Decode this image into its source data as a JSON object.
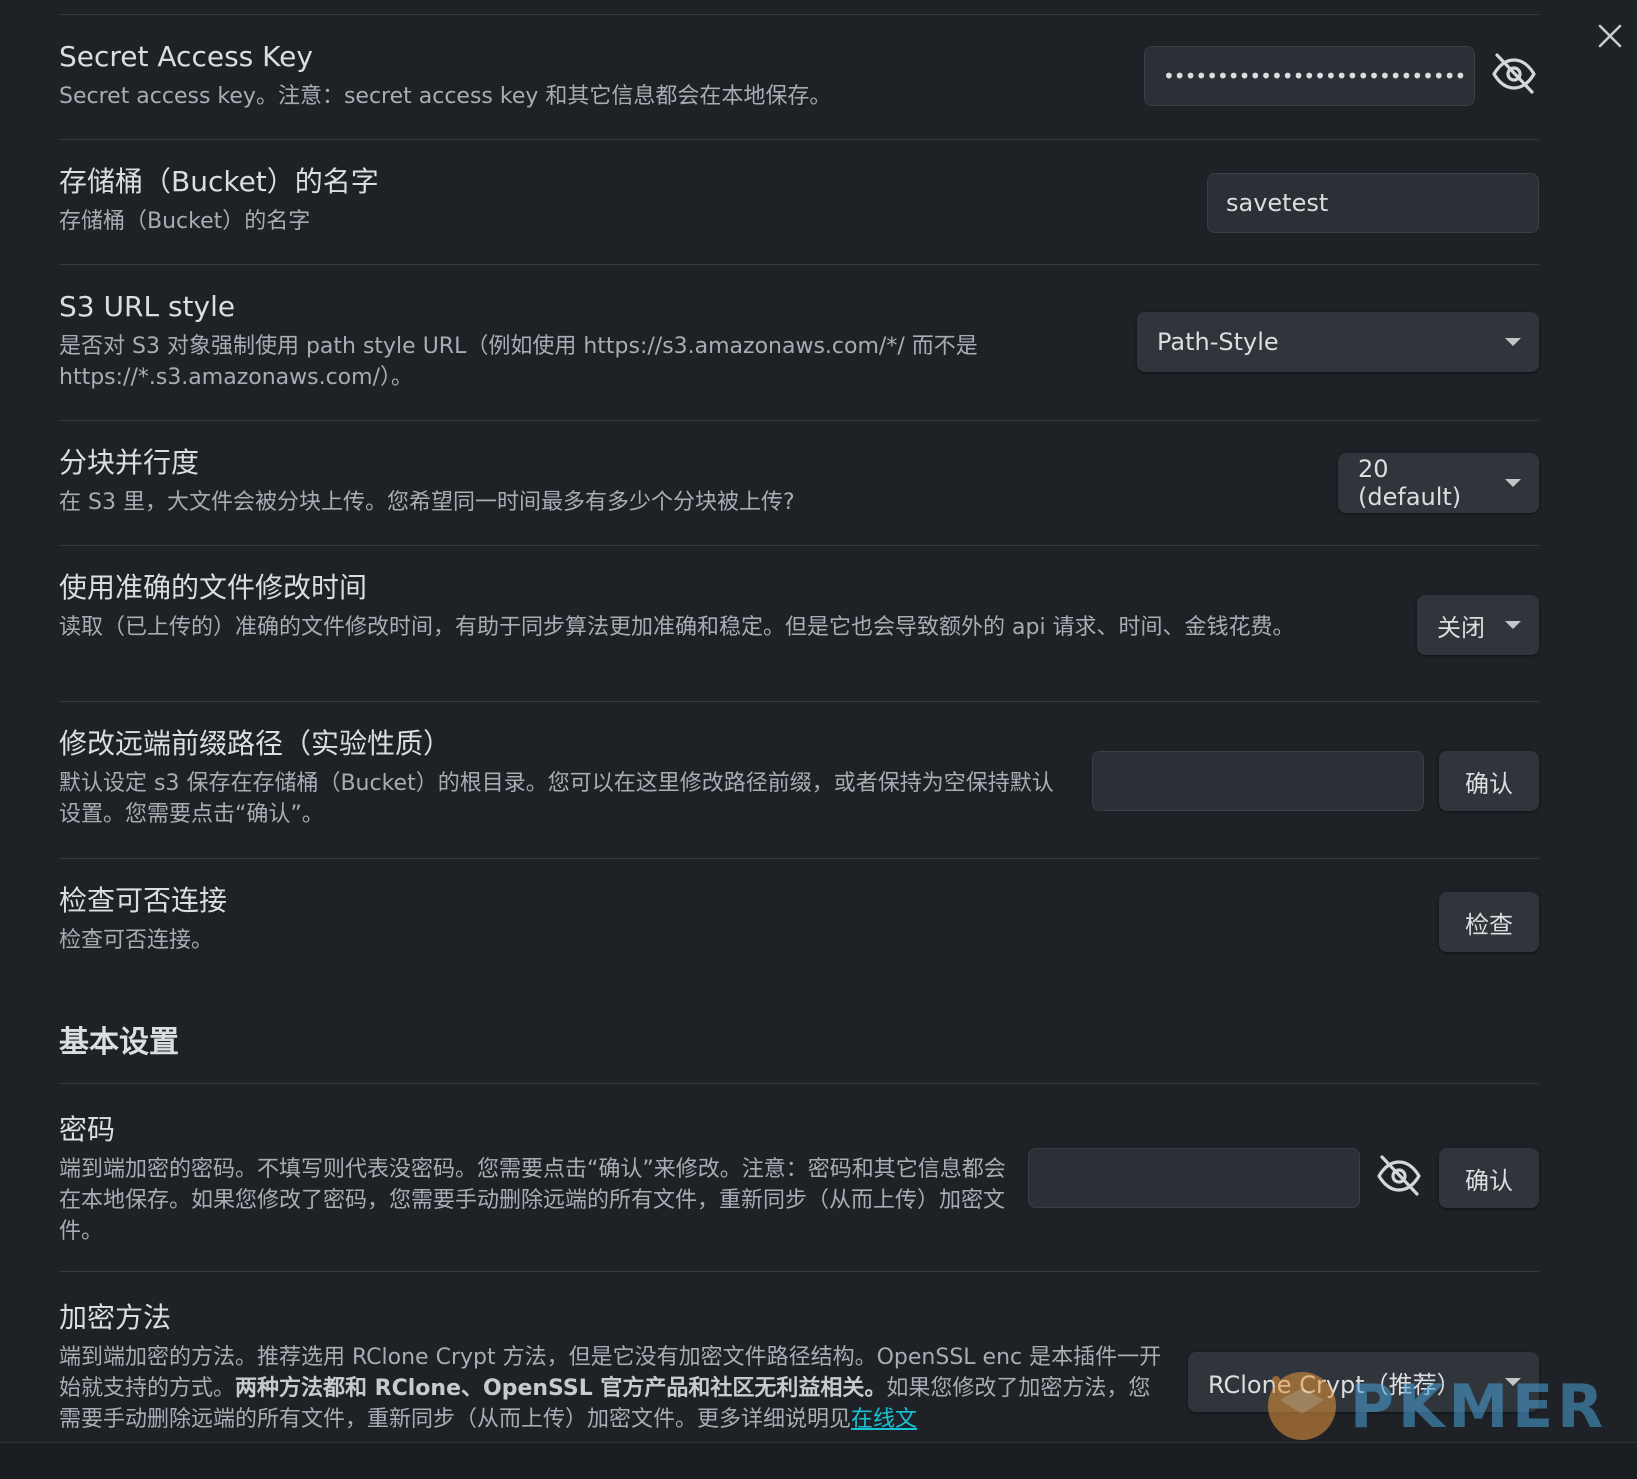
{
  "settings": {
    "secret_key": {
      "name": "Secret Access Key",
      "desc": "Secret access key。注意：secret access key 和其它信息都会在本地保存。",
      "value": "••••••••••••••••••••••••••••"
    },
    "bucket": {
      "name": "存储桶（Bucket）的名字",
      "desc": "存储桶（Bucket）的名字",
      "value": "savetest"
    },
    "url_style": {
      "name": "S3 URL style",
      "desc": "是否对 S3 对象强制使用 path style URL（例如使用 https://s3.amazonaws.com/*/ 而不是 https://*.s3.amazonaws.com/）。",
      "value": "Path-Style"
    },
    "parallel": {
      "name": "分块并行度",
      "desc": "在 S3 里，大文件会被分块上传。您希望同一时间最多有多少个分块被上传?",
      "value": "20 (default)"
    },
    "mtime": {
      "name": "使用准确的文件修改时间",
      "desc": "读取（已上传的）准确的文件修改时间，有助于同步算法更加准确和稳定。但是它也会导致额外的 api 请求、时间、金钱花费。",
      "value": "关闭"
    },
    "prefix": {
      "name": "修改远端前缀路径（实验性质）",
      "desc": "默认设定 s3 保存在存储桶（Bucket）的根目录。您可以在这里修改路径前缀，或者保持为空保持默认设置。您需要点击“确认”。",
      "value": "",
      "button": "确认"
    },
    "check": {
      "name": "检查可否连接",
      "desc": "检查可否连接。",
      "button": "检查"
    },
    "basic_heading": "基本设置",
    "password": {
      "name": "密码",
      "desc": "端到端加密的密码。不填写则代表没密码。您需要点击“确认”来修改。注意：密码和其它信息都会在本地保存。如果您修改了密码，您需要手动删除远端的所有文件，重新同步（从而上传）加密文件。",
      "value": "",
      "button": "确认"
    },
    "encrypt": {
      "name": "加密方法",
      "desc_1": "端到端加密的方法。推荐选用 RClone Crypt 方法，但是它没有加密文件路径结构。OpenSSL enc 是本插件一开始就支持的方式。",
      "desc_strong": "两种方法都和 RClone、OpenSSL 官方产品和社区无利益相关。",
      "desc_2": "如果您修改了加密方法，您需要手动删除远端的所有文件，重新同步（从而上传）加密文件。更多详细说明见",
      "desc_link": "在线文",
      "value": "RClone Crypt（推荐）"
    }
  },
  "watermark": "PKMER",
  "icons": {
    "close": "close-icon",
    "eye_off": "eye-off-icon",
    "caret": "chevron-down-icon"
  }
}
